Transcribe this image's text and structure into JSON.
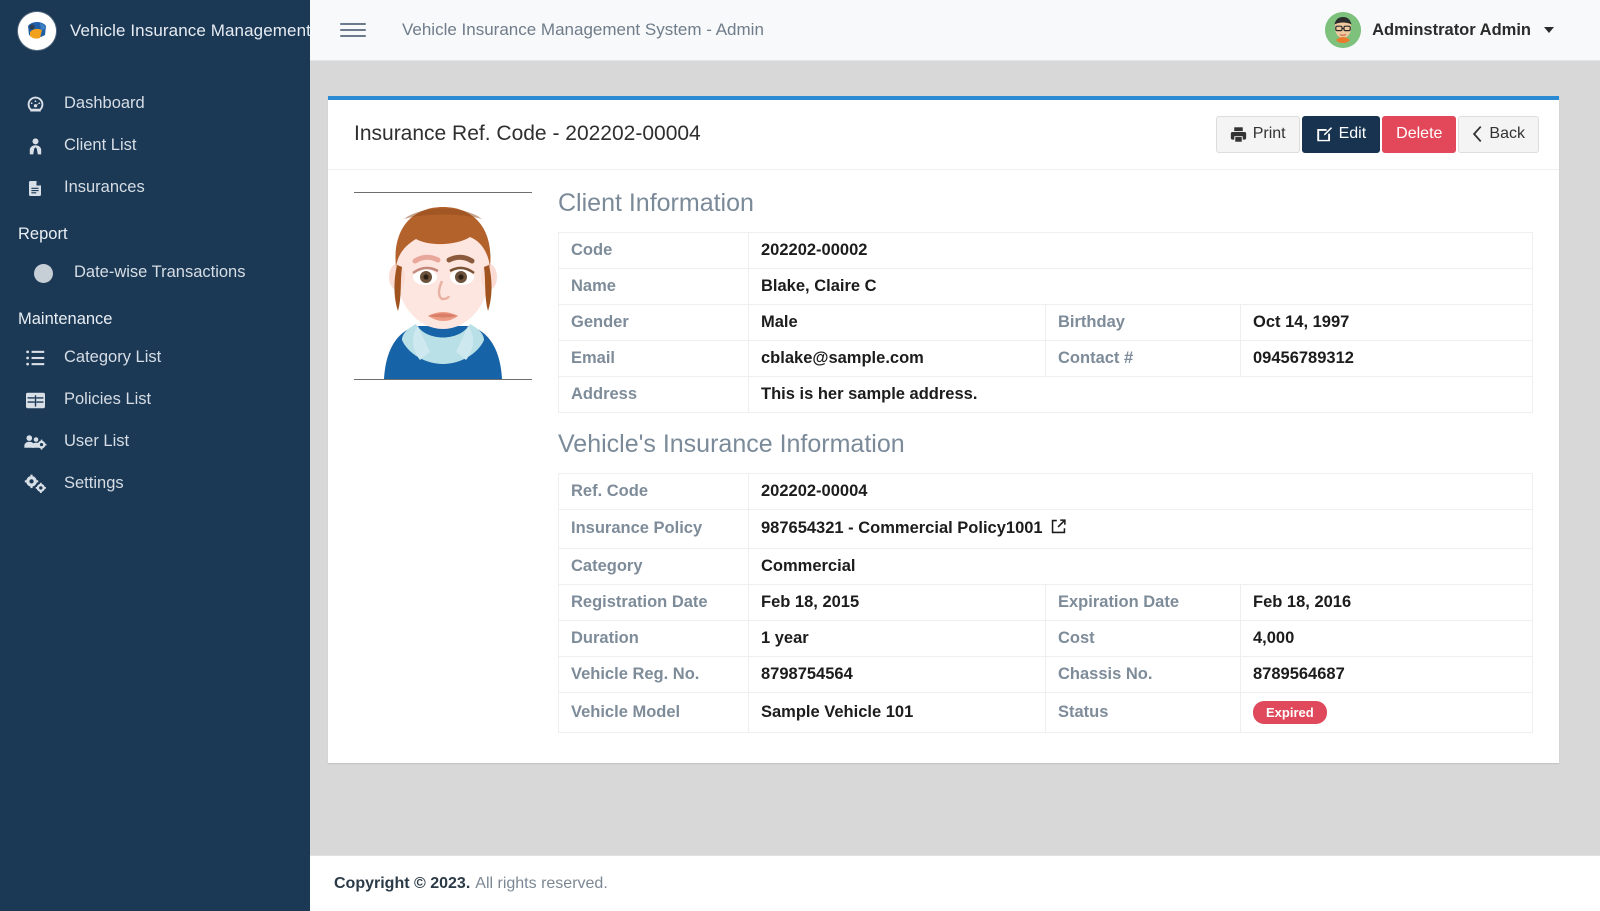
{
  "sidebar": {
    "brand": "Vehicle Insurance Management",
    "brand_logo_icon": "insurance-logo-icon",
    "items": [
      {
        "label": "Dashboard",
        "icon": "dashboard-gauge-icon"
      },
      {
        "label": "Client List",
        "icon": "user-tie-icon"
      },
      {
        "label": "Insurances",
        "icon": "document-icon"
      }
    ],
    "report_header": "Report",
    "report_items": [
      {
        "label": "Date-wise Transactions",
        "icon": "circle-icon"
      }
    ],
    "maintenance_header": "Maintenance",
    "maintenance_items": [
      {
        "label": "Category List",
        "icon": "list-icon"
      },
      {
        "label": "Policies List",
        "icon": "table-grid-icon"
      },
      {
        "label": "User List",
        "icon": "users-cog-icon"
      },
      {
        "label": "Settings",
        "icon": "cogs-icon"
      }
    ]
  },
  "topbar": {
    "menu_icon": "hamburger-icon",
    "title": "Vehicle Insurance Management System - Admin",
    "user_name": "Adminstrator Admin",
    "avatar_icon": "user-avatar-icon",
    "caret_icon": "caret-down-icon"
  },
  "card": {
    "title": "Insurance Ref. Code - 202202-00004",
    "accent_color": "#2a8ad4",
    "buttons": [
      {
        "label": "Print",
        "icon": "printer-icon",
        "style": "default"
      },
      {
        "label": "Edit",
        "icon": "edit-pencil-square-icon",
        "style": "primary"
      },
      {
        "label": "Delete",
        "icon": "",
        "style": "danger"
      },
      {
        "label": "Back",
        "icon": "chevron-left-icon",
        "style": "default"
      }
    ]
  },
  "client": {
    "section_title": "Client Information",
    "photo_icon": "client-portrait-photo",
    "rows": [
      {
        "label": "Code",
        "value": "202202-00002"
      },
      {
        "label": "Name",
        "value": "Blake, Claire C"
      },
      {
        "label": "Gender",
        "value": "Male",
        "label2": "Birthday",
        "value2": "Oct 14, 1997"
      },
      {
        "label": "Email",
        "value": "cblake@sample.com",
        "label2": "Contact #",
        "value2": "09456789312"
      },
      {
        "label": "Address",
        "value": "This is her sample address."
      }
    ]
  },
  "insurance": {
    "section_title": "Vehicle's Insurance Information",
    "rows": [
      {
        "label": "Ref. Code",
        "value": "202202-00004"
      },
      {
        "label": "Insurance Policy",
        "value": "987654321 - Commercial Policy1001",
        "link_icon": "external-link-icon"
      },
      {
        "label": "Category",
        "value": "Commercial"
      },
      {
        "label": "Registration Date",
        "value": "Feb 18, 2015",
        "label2": "Expiration Date",
        "value2": "Feb 18, 2016"
      },
      {
        "label": "Duration",
        "value": "1 year",
        "label2": "Cost",
        "value2": "4,000"
      },
      {
        "label": "Vehicle Reg. No.",
        "value": "8798754564",
        "label2": "Chassis No.",
        "value2": "8789564687"
      },
      {
        "label": "Vehicle Model",
        "value": "Sample Vehicle 101",
        "label2": "Status",
        "status_badge": "Expired",
        "status_color": "#e0485b"
      }
    ]
  },
  "footer": {
    "copyright": "Copyright © 2023.",
    "rights": "All rights reserved."
  }
}
